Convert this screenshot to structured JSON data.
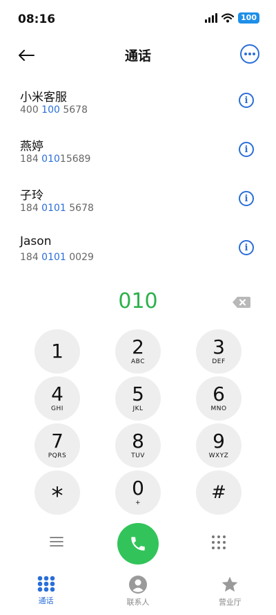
{
  "status_bar": {
    "time": "08:16",
    "battery": "100"
  },
  "header": {
    "title": "通话"
  },
  "contacts": [
    {
      "name": "小米客服",
      "number_parts": [
        "400 ",
        "100",
        " 5678"
      ]
    },
    {
      "name": "燕婷",
      "number_parts": [
        "184 ",
        "010",
        "15689"
      ]
    },
    {
      "name": "子玲",
      "number_parts": [
        "184 ",
        "0101",
        " 5678"
      ]
    },
    {
      "name": "Jason",
      "number_parts": [
        "184 ",
        "0101",
        " 0029"
      ]
    }
  ],
  "dial_display": {
    "value": "010"
  },
  "keypad": [
    {
      "digit": "1",
      "letters": ""
    },
    {
      "digit": "2",
      "letters": "ABC"
    },
    {
      "digit": "3",
      "letters": "DEF"
    },
    {
      "digit": "4",
      "letters": "GHI"
    },
    {
      "digit": "5",
      "letters": "JKL"
    },
    {
      "digit": "6",
      "letters": "MNO"
    },
    {
      "digit": "7",
      "letters": "PQRS"
    },
    {
      "digit": "8",
      "letters": "TUV"
    },
    {
      "digit": "9",
      "letters": "WXYZ"
    },
    {
      "digit": "*",
      "letters": ""
    },
    {
      "digit": "0",
      "letters": "+"
    },
    {
      "digit": "#",
      "letters": ""
    }
  ],
  "tabs": [
    {
      "label": "通话",
      "icon": "dialpad-grid-icon",
      "active": true
    },
    {
      "label": "联系人",
      "icon": "person-icon",
      "active": false
    },
    {
      "label": "营业厅",
      "icon": "star-icon",
      "active": false
    }
  ],
  "colors": {
    "accent_blue": "#2a6ed8",
    "dial_green": "#2ab24a",
    "call_green": "#32c45a",
    "key_bg": "#eeeeee"
  }
}
